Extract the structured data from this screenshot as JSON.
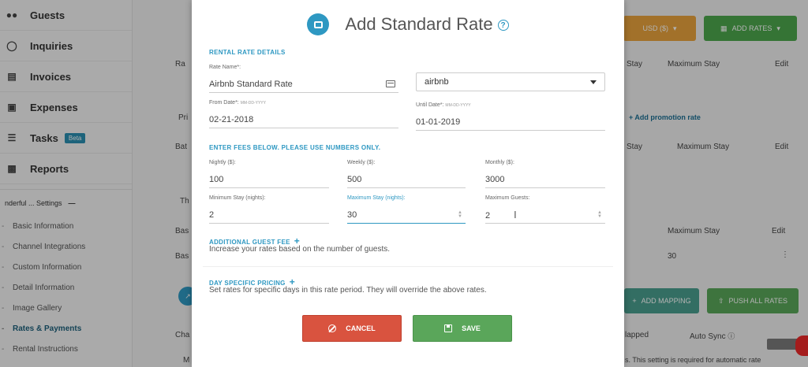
{
  "sidebar": {
    "items": [
      {
        "label": "Guests",
        "icon": "users-icon"
      },
      {
        "label": "Inquiries",
        "icon": "chat-icon"
      },
      {
        "label": "Invoices",
        "icon": "invoice-icon"
      },
      {
        "label": "Expenses",
        "icon": "money-icon"
      },
      {
        "label": "Tasks",
        "icon": "list-icon",
        "badge": "Beta"
      },
      {
        "label": "Reports",
        "icon": "chart-icon"
      }
    ],
    "settings_header": "nderful ... Settings",
    "settings_items": [
      {
        "label": "Basic Information"
      },
      {
        "label": "Channel Integrations"
      },
      {
        "label": "Custom Information"
      },
      {
        "label": "Detail Information"
      },
      {
        "label": "Image Gallery"
      },
      {
        "label": "Rates & Payments",
        "active": true
      },
      {
        "label": "Rental Instructions"
      }
    ]
  },
  "background": {
    "currency_button": "USD ($)",
    "add_rates_button": "ADD RATES",
    "col_stay": "Stay",
    "col_max_stay": "Maximum Stay",
    "col_edit": "Edit",
    "add_promo": "+ Add promotion rate",
    "col_stay_2": "Stay",
    "col_max_stay_2": "Maximum Stay",
    "col_edit_2": "Edit",
    "col_max_stay_3": "Maximum Stay",
    "col_edit_3": "Edit",
    "row_value": "30",
    "add_mapping": "ADD MAPPING",
    "push_all_rates": "PUSH ALL RATES",
    "mapped": "lapped",
    "auto_sync": "Auto Sync",
    "auto_note": "s. This setting is required for automatic rate",
    "frag_ra": "Ra",
    "frag_pri": "Pri",
    "frag_bat": "Bat",
    "frag_th": "Th",
    "frag_bas": "Bas",
    "frag_bas2": "Bas",
    "frag_cha": "Cha",
    "frag_m": "M"
  },
  "modal": {
    "title": "Add Standard Rate",
    "rental_section": "RENTAL RATE DETAILS",
    "rate_name_label": "Rate Name",
    "rate_name_value": "Airbnb Standard Rate",
    "channel_value": "airbnb",
    "from_date_label": "From Date",
    "from_date_format": "MM-DD-YYYY",
    "from_date_value": "02-21-2018",
    "until_date_label": "Until Date",
    "until_date_format": "MM-DD-YYYY",
    "until_date_value": "01-01-2019",
    "fees_section": "ENTER FEES BELOW. PLEASE USE NUMBERS ONLY.",
    "nightly_label": "Nightly ($):",
    "nightly_value": "100",
    "weekly_label": "Weekly ($):",
    "weekly_value": "500",
    "monthly_label": "Monthly ($):",
    "monthly_value": "3000",
    "min_stay_label": "Minimum Stay (nights):",
    "min_stay_value": "2",
    "max_stay_label": "Maximum Stay (nights):",
    "max_stay_value": "30",
    "max_guests_label": "Maximum Guests:",
    "max_guests_value": "2",
    "guest_fee_section": "ADDITIONAL GUEST FEE",
    "guest_fee_desc": "Increase your rates based on the number of guests.",
    "day_pricing_section": "DAY SPECIFIC PRICING",
    "day_pricing_desc": "Set rates for specific days in this rate period. They will override the above rates.",
    "cancel_label": "CANCEL",
    "save_label": "SAVE"
  },
  "colors": {
    "accent": "#2e98c2",
    "cancel": "#d9533f",
    "save": "#5aa65a",
    "currency_bg": "#e8a33d",
    "add_rates_bg": "#4da64d"
  }
}
